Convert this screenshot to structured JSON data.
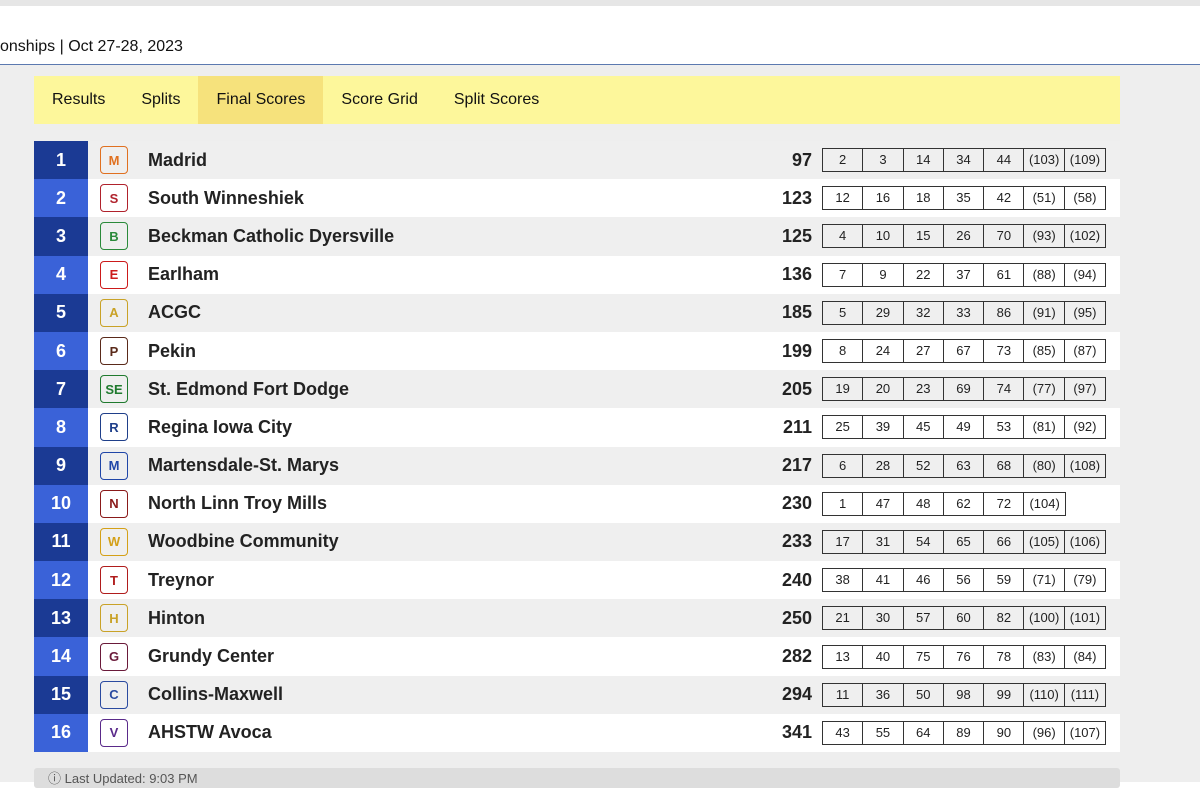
{
  "header": {
    "title": "onships | Oct 27-28, 2023"
  },
  "tabs": [
    {
      "label": "Results",
      "active": false
    },
    {
      "label": "Splits",
      "active": false
    },
    {
      "label": "Final Scores",
      "active": true
    },
    {
      "label": "Score Grid",
      "active": false
    },
    {
      "label": "Split Scores",
      "active": false
    }
  ],
  "teams": [
    {
      "place": "1",
      "name": "Madrid",
      "score": "97",
      "runners": [
        "2",
        "3",
        "14",
        "34",
        "44",
        "(103)",
        "(109)"
      ],
      "logo_color": "#e07020",
      "logo_glyph": "M"
    },
    {
      "place": "2",
      "name": "South Winneshiek",
      "score": "123",
      "runners": [
        "12",
        "16",
        "18",
        "35",
        "42",
        "(51)",
        "(58)"
      ],
      "logo_color": "#b0222c",
      "logo_glyph": "S"
    },
    {
      "place": "3",
      "name": "Beckman Catholic Dyersville",
      "score": "125",
      "runners": [
        "4",
        "10",
        "15",
        "26",
        "70",
        "(93)",
        "(102)"
      ],
      "logo_color": "#2a8a3a",
      "logo_glyph": "B"
    },
    {
      "place": "4",
      "name": "Earlham",
      "score": "136",
      "runners": [
        "7",
        "9",
        "22",
        "37",
        "61",
        "(88)",
        "(94)"
      ],
      "logo_color": "#cc1a1a",
      "logo_glyph": "E"
    },
    {
      "place": "5",
      "name": "ACGC",
      "score": "185",
      "runners": [
        "5",
        "29",
        "32",
        "33",
        "86",
        "(91)",
        "(95)"
      ],
      "logo_color": "#c9a227",
      "logo_glyph": "A"
    },
    {
      "place": "6",
      "name": "Pekin",
      "score": "199",
      "runners": [
        "8",
        "24",
        "27",
        "67",
        "73",
        "(85)",
        "(87)"
      ],
      "logo_color": "#5a2a1a",
      "logo_glyph": "P"
    },
    {
      "place": "7",
      "name": "St. Edmond Fort Dodge",
      "score": "205",
      "runners": [
        "19",
        "20",
        "23",
        "69",
        "74",
        "(77)",
        "(97)"
      ],
      "logo_color": "#1f7a2e",
      "logo_glyph": "SE"
    },
    {
      "place": "8",
      "name": "Regina Iowa City",
      "score": "211",
      "runners": [
        "25",
        "39",
        "45",
        "49",
        "53",
        "(81)",
        "(92)"
      ],
      "logo_color": "#1f3f8a",
      "logo_glyph": "R"
    },
    {
      "place": "9",
      "name": "Martensdale-St. Marys",
      "score": "217",
      "runners": [
        "6",
        "28",
        "52",
        "63",
        "68",
        "(80)",
        "(108)"
      ],
      "logo_color": "#2046a8",
      "logo_glyph": "M"
    },
    {
      "place": "10",
      "name": "North Linn Troy Mills",
      "score": "230",
      "runners": [
        "1",
        "47",
        "48",
        "62",
        "72",
        "(104)"
      ],
      "logo_color": "#8a1a1a",
      "logo_glyph": "N"
    },
    {
      "place": "11",
      "name": "Woodbine Community",
      "score": "233",
      "runners": [
        "17",
        "31",
        "54",
        "65",
        "66",
        "(105)",
        "(106)"
      ],
      "logo_color": "#d4a017",
      "logo_glyph": "W"
    },
    {
      "place": "12",
      "name": "Treynor",
      "score": "240",
      "runners": [
        "38",
        "41",
        "46",
        "56",
        "59",
        "(71)",
        "(79)"
      ],
      "logo_color": "#b01c1c",
      "logo_glyph": "T"
    },
    {
      "place": "13",
      "name": "Hinton",
      "score": "250",
      "runners": [
        "21",
        "30",
        "57",
        "60",
        "82",
        "(100)",
        "(101)"
      ],
      "logo_color": "#c9a227",
      "logo_glyph": "H"
    },
    {
      "place": "14",
      "name": "Grundy Center",
      "score": "282",
      "runners": [
        "13",
        "40",
        "75",
        "76",
        "78",
        "(83)",
        "(84)"
      ],
      "logo_color": "#6a1a3a",
      "logo_glyph": "G"
    },
    {
      "place": "15",
      "name": "Collins-Maxwell",
      "score": "294",
      "runners": [
        "11",
        "36",
        "50",
        "98",
        "99",
        "(110)",
        "(111)"
      ],
      "logo_color": "#2a4aa0",
      "logo_glyph": "C"
    },
    {
      "place": "16",
      "name": "AHSTW Avoca",
      "score": "341",
      "runners": [
        "43",
        "55",
        "64",
        "89",
        "90",
        "(96)",
        "(107)"
      ],
      "logo_color": "#5a2a8a",
      "logo_glyph": "V"
    }
  ],
  "footer": {
    "text": "Last Updated: 9:03 PM"
  },
  "colors": {
    "tab_bar": "#fdf79b",
    "tab_active": "#f6e27c",
    "place_dark": "#1b3a94",
    "place_light": "#3a62d8"
  }
}
